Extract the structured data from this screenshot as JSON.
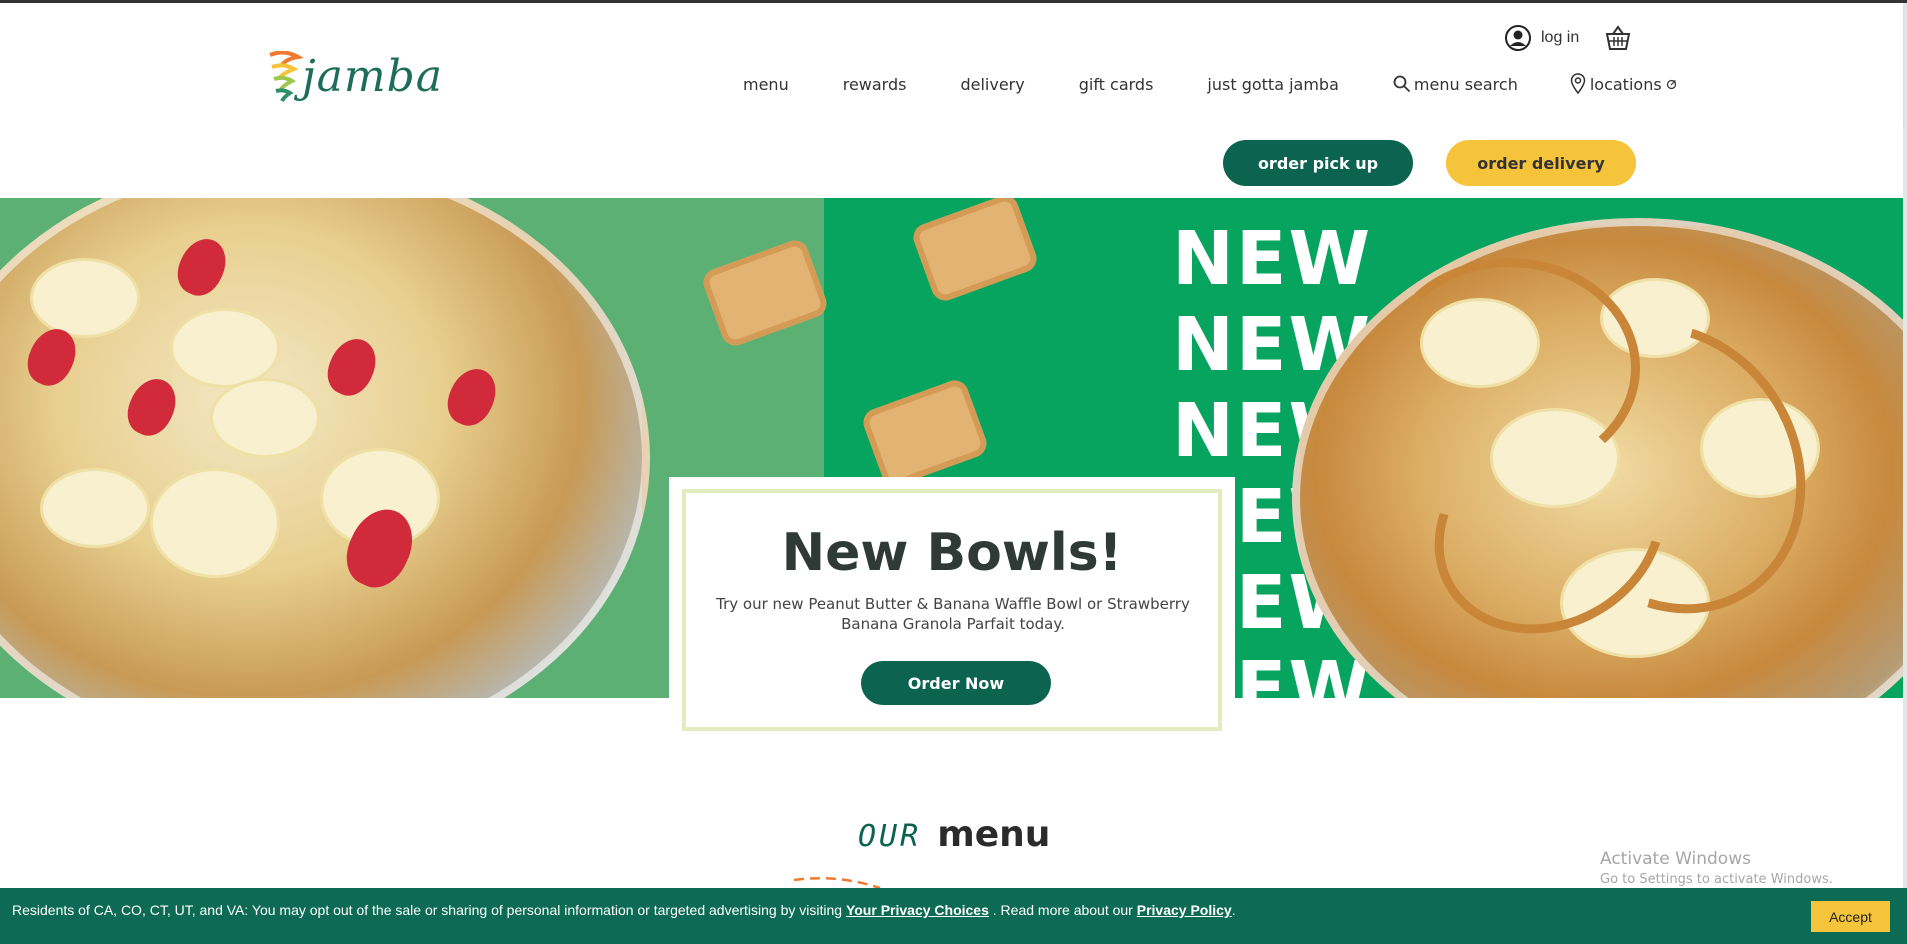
{
  "header": {
    "logo_text": "jamba",
    "login_label": "log in",
    "nav": {
      "menu": "menu",
      "rewards": "rewards",
      "delivery": "delivery",
      "gift_cards": "gift cards",
      "just_gotta_jamba": "just gotta jamba",
      "menu_search": "menu search",
      "locations": "locations"
    },
    "icons": [
      "user-icon",
      "basket-icon",
      "search-icon",
      "location-pin-icon",
      "external-link-icon"
    ]
  },
  "order_buttons": {
    "pickup": "order pick up",
    "delivery": "order delivery"
  },
  "hero": {
    "new_lines": [
      "NEW",
      "NEW",
      "NEW",
      "NEW",
      "NEW",
      "NEW"
    ],
    "card": {
      "title": "New Bowls!",
      "text": "Try our new Peanut Butter & Banana Waffle Bowl or Strawberry Banana Granola Parfait today.",
      "button": "Order Now"
    }
  },
  "menu_section": {
    "prefix": "OUR",
    "title": "menu"
  },
  "watermark": {
    "title": "Activate Windows",
    "subtitle": "Go to Settings to activate Windows."
  },
  "cookie_bar": {
    "text_before": "Residents of CA, CO, CT, UT, and VA: You may opt out of the sale or sharing of personal information or targeted advertising by visiting ",
    "privacy_choices_link": "Your Privacy Choices",
    "text_middle": " . Read more about our ",
    "privacy_policy_link": "Privacy Policy",
    "text_after": ".",
    "accept": "Accept"
  },
  "colors": {
    "brand_green": "#0c6350",
    "brand_yellow": "#f5c43a",
    "hero_green_left": "#5cb074",
    "hero_green_right": "#06a45e",
    "cookie_bg": "#0d6b55"
  }
}
